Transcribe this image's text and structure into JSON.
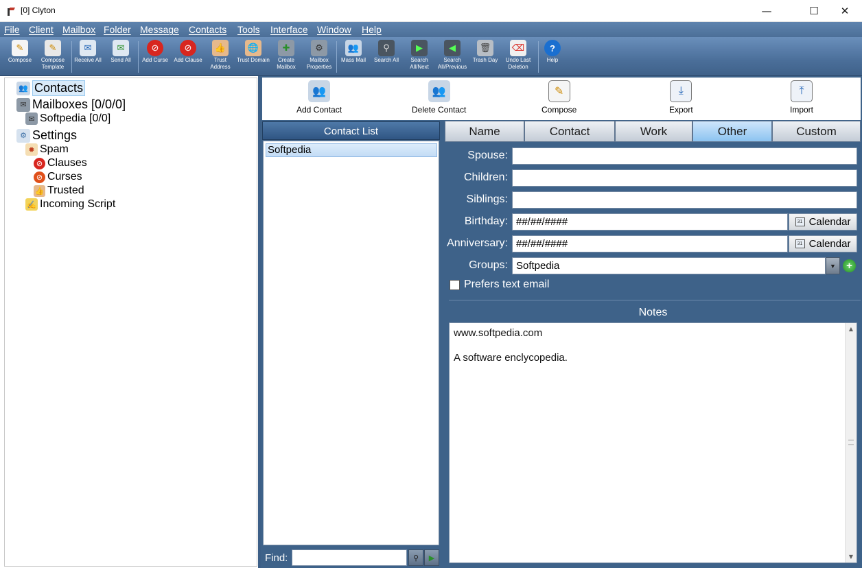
{
  "window": {
    "title": "[0] Clyton",
    "minimize": "—",
    "maximize": "☐",
    "close": "✕"
  },
  "menu": [
    "File",
    "Client",
    "Mailbox",
    "Folder",
    "Message",
    "Contacts",
    "Tools",
    "Interface",
    "Window",
    "Help"
  ],
  "toolbar": [
    {
      "label": "Compose",
      "icon": "compose-icon"
    },
    {
      "label": "Compose Template",
      "icon": "compose-template-icon"
    },
    {
      "label": "Receive All",
      "icon": "receive-all-icon"
    },
    {
      "label": "Send All",
      "icon": "send-all-icon"
    },
    {
      "label": "Add Curse",
      "icon": "add-curse-icon"
    },
    {
      "label": "Add Clause",
      "icon": "add-clause-icon"
    },
    {
      "label": "Trust Address",
      "icon": "trust-address-icon"
    },
    {
      "label": "Trust Domain",
      "icon": "trust-domain-icon"
    },
    {
      "label": "Create Mailbox",
      "icon": "create-mailbox-icon"
    },
    {
      "label": "Mailbox Properties",
      "icon": "mailbox-properties-icon"
    },
    {
      "label": "Mass Mail",
      "icon": "mass-mail-icon"
    },
    {
      "label": "Search All",
      "icon": "search-all-icon"
    },
    {
      "label": "Search All/Next",
      "icon": "search-next-icon"
    },
    {
      "label": "Search All/Previous",
      "icon": "search-previous-icon"
    },
    {
      "label": "Trash Day",
      "icon": "trash-icon"
    },
    {
      "label": "Undo Last Deletion",
      "icon": "undo-deletion-icon"
    },
    {
      "label": "Help",
      "icon": "help-icon"
    }
  ],
  "tree": {
    "contacts": "Contacts",
    "mailboxes": "Mailboxes [0/0/0]",
    "softpedia": "Softpedia [0/0]",
    "settings": "Settings",
    "spam": "Spam",
    "clauses": "Clauses",
    "curses": "Curses",
    "trusted": "Trusted",
    "incoming": "Incoming Script"
  },
  "actions": {
    "add_contact": "Add Contact",
    "delete_contact": "Delete Contact",
    "compose": "Compose",
    "export": "Export",
    "import": "Import"
  },
  "contact_list": {
    "header": "Contact List",
    "items": [
      "Softpedia"
    ],
    "find_label": "Find:",
    "find_value": ""
  },
  "tabs": [
    "Name",
    "Contact",
    "Work",
    "Other",
    "Custom"
  ],
  "active_tab": "Other",
  "form": {
    "spouse_label": "Spouse:",
    "spouse_value": "",
    "children_label": "Children:",
    "children_value": "",
    "siblings_label": "Siblings:",
    "siblings_value": "",
    "birthday_label": "Birthday:",
    "birthday_value": "##/##/####",
    "anniversary_label": "Anniversary:",
    "anniversary_value": "##/##/####",
    "calendar_label": "Calendar",
    "groups_label": "Groups:",
    "groups_value": "Softpedia",
    "prefers_text_label": "Prefers text email",
    "prefers_text_checked": false
  },
  "notes": {
    "label": "Notes",
    "line1": "www.softpedia.com",
    "line2": "A software enclycopedia."
  },
  "colors": {
    "panel": "#3e6289",
    "menu": "#5479a4",
    "accent": "#8cc3f0"
  }
}
